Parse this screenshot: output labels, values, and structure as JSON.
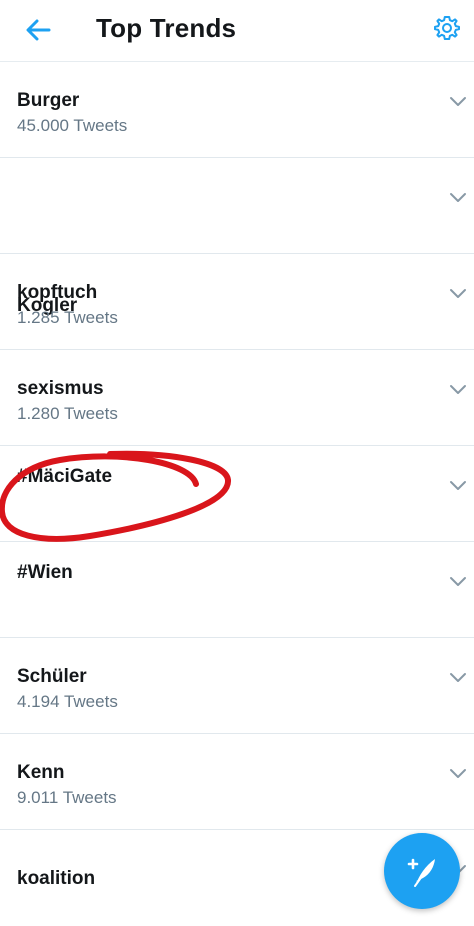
{
  "header": {
    "title": "Top Trends",
    "back_icon": "arrow-left-icon",
    "settings_icon": "gear-icon"
  },
  "trends": [
    {
      "name": "Burger",
      "count": "45.000 Tweets"
    },
    {
      "name": "Kogler",
      "count": ""
    },
    {
      "name": "kopftuch",
      "count": "1.285 Tweets"
    },
    {
      "name": "sexismus",
      "count": "1.280 Tweets"
    },
    {
      "name": "#MäciGate",
      "count": ""
    },
    {
      "name": "#Wien",
      "count": ""
    },
    {
      "name": "Schüler",
      "count": "4.194 Tweets"
    },
    {
      "name": "Kenn",
      "count": "9.011 Tweets"
    },
    {
      "name": "koalition",
      "count": ""
    }
  ],
  "fab": {
    "icon": "compose-tweet-icon"
  },
  "colors": {
    "accent": "#1da1f2",
    "text": "#14171a",
    "secondary_text": "#657786",
    "divider": "#e1e8ed",
    "annotation": "#d9151b"
  }
}
